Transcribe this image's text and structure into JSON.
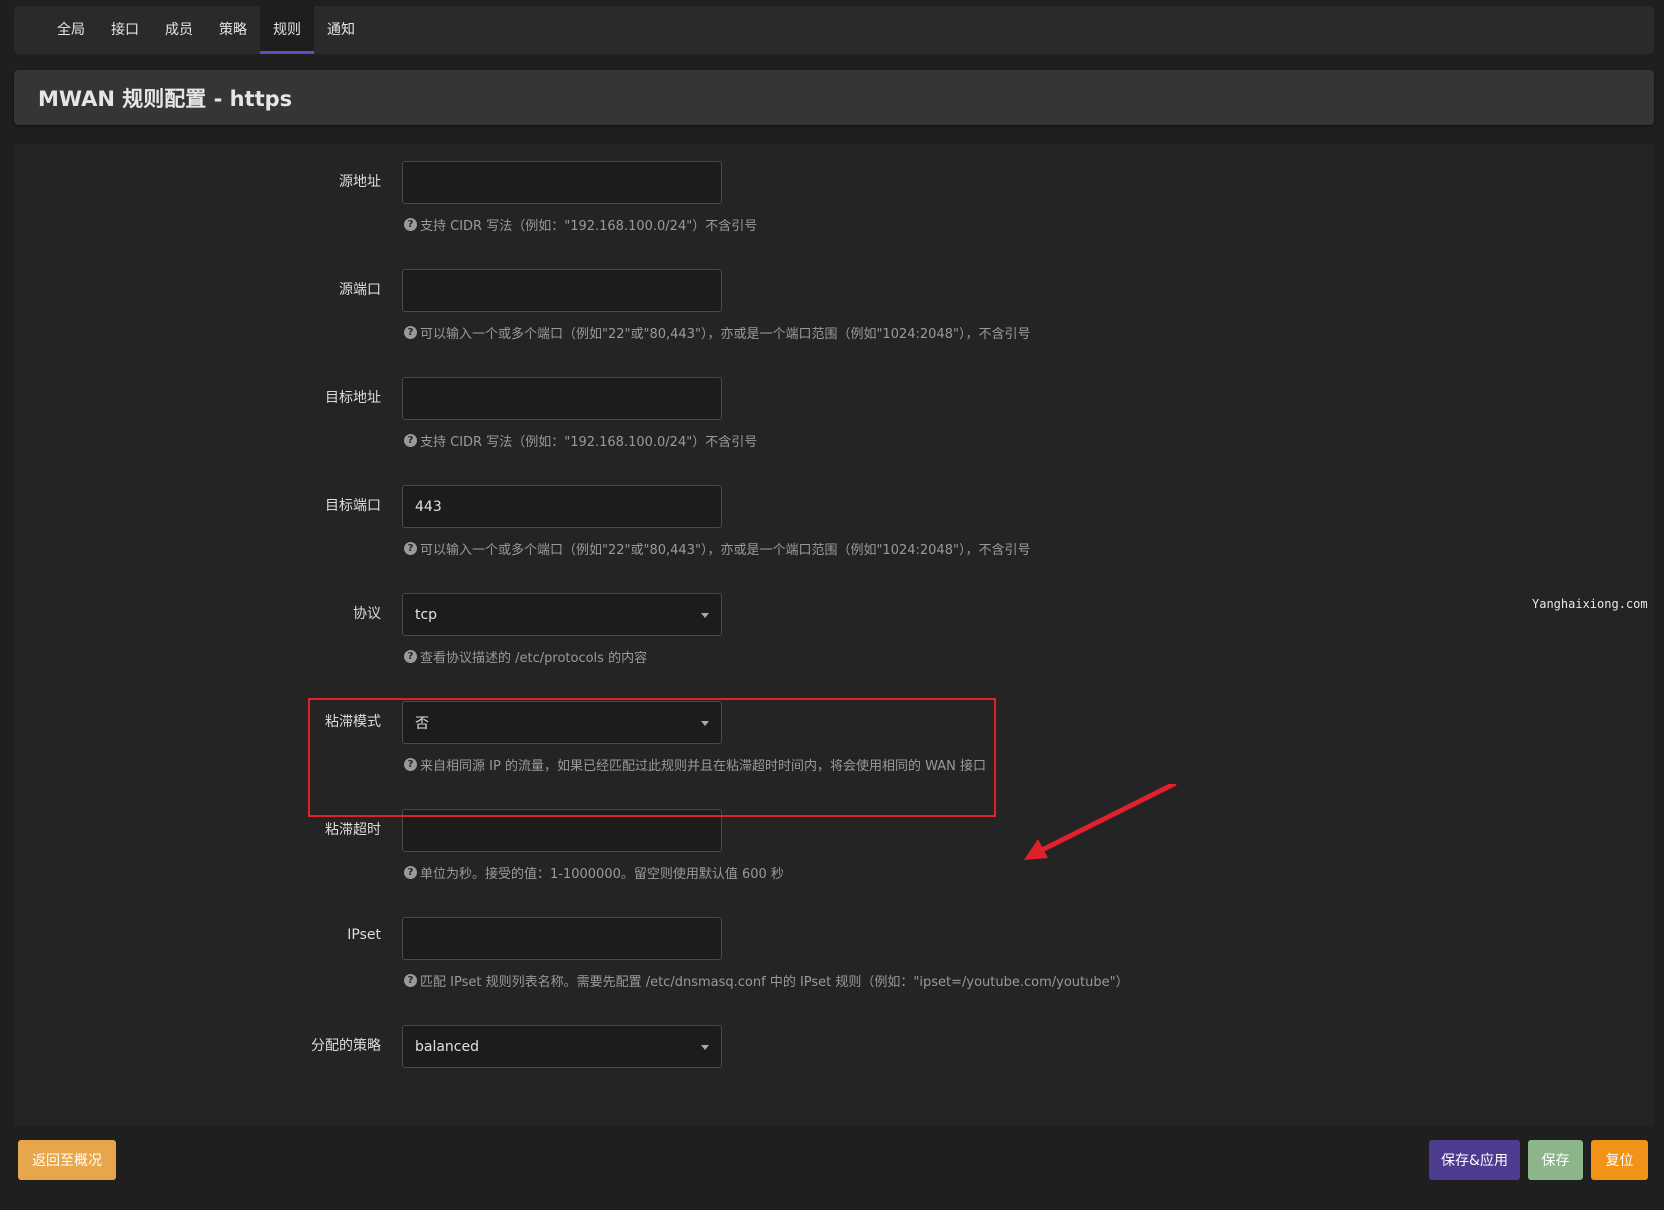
{
  "tabs": [
    {
      "label": "全局"
    },
    {
      "label": "接口"
    },
    {
      "label": "成员"
    },
    {
      "label": "策略"
    },
    {
      "label": "规则",
      "active": true
    },
    {
      "label": "通知"
    }
  ],
  "page": {
    "title": "MWAN 规则配置 - https"
  },
  "form": {
    "src_ip": {
      "label": "源地址",
      "value": "",
      "hint": "支持 CIDR 写法（例如：\"192.168.100.0/24\"）不含引号"
    },
    "src_port": {
      "label": "源端口",
      "value": "",
      "hint": "可以输入一个或多个端口（例如\"22\"或\"80,443\"），亦或是一个端口范围（例如\"1024:2048\"），不含引号"
    },
    "dest_ip": {
      "label": "目标地址",
      "value": "",
      "hint": "支持 CIDR 写法（例如：\"192.168.100.0/24\"）不含引号"
    },
    "dest_port": {
      "label": "目标端口",
      "value": "443",
      "hint": "可以输入一个或多个端口（例如\"22\"或\"80,443\"），亦或是一个端口范围（例如\"1024:2048\"），不含引号"
    },
    "proto": {
      "label": "协议",
      "value": "tcp",
      "hint": "查看协议描述的 /etc/protocols 的内容"
    },
    "sticky": {
      "label": "粘滞模式",
      "value": "否",
      "hint": "来自相同源 IP 的流量，如果已经匹配过此规则并且在粘滞超时时间内，将会使用相同的 WAN 接口"
    },
    "timeout": {
      "label": "粘滞超时",
      "value": "",
      "hint": "单位为秒。接受的值：1-1000000。留空则使用默认值 600 秒"
    },
    "ipset": {
      "label": "IPset",
      "value": "",
      "hint": "匹配 IPset 规则列表名称。需要先配置 /etc/dnsmasq.conf 中的 IPset 规则（例如：\"ipset=/youtube.com/youtube\"）"
    },
    "policy": {
      "label": "分配的策略",
      "value": "balanced"
    }
  },
  "watermark": "Yanghaixiong.com",
  "buttons": {
    "back": "返回至概况",
    "save_apply": "保存&应用",
    "save": "保存",
    "reset": "复位"
  },
  "colors": {
    "accent": "#5b4fc4",
    "highlight": "#e0202a",
    "btn_back": "#e8a64a",
    "btn_apply": "#4d3b8f",
    "btn_save": "#8db58a",
    "btn_reset": "#f29317"
  },
  "icons": {
    "hint": "question-circle-icon",
    "select": "caret-down-icon",
    "annotation": "red-arrow-icon"
  }
}
